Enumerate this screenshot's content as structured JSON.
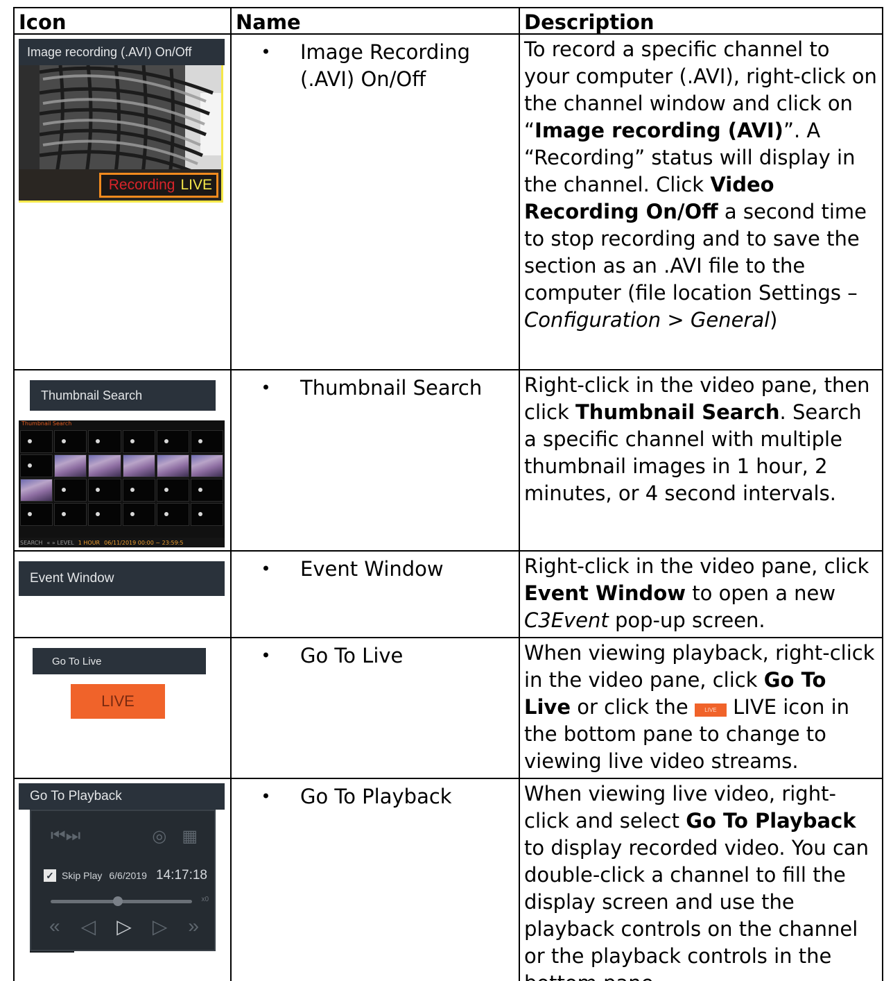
{
  "headers": {
    "icon": "Icon",
    "name": "Name",
    "description": "Description"
  },
  "rows": [
    {
      "name": "Image Recording (.AVI) On/Off",
      "image": {
        "menu_label": "Image recording (.AVI) On/Off",
        "overlay_status": "Recording",
        "overlay_live": "LIVE"
      },
      "desc": {
        "p1": "To record a specific channel to your computer (.AVI), right-click on the channel window and click on “",
        "b1": "Image recording (AVI)",
        "p2": "”.  A “Recording” status will display in the channel.  Click ",
        "b2": "Video Recording On/Off",
        "p3": " a second time to stop recording and to save the section as an .AVI file to the computer (file location Settings –  ",
        "i1": "Configuration > General",
        "p4": ")"
      }
    },
    {
      "name": "Thumbnail Search",
      "image": {
        "menu_label": "Thumbnail Search",
        "window_title": "Thumbnail Search",
        "footer_search": "SEARCH",
        "footer_level": "LEVEL",
        "footer_hour": "1 HOUR",
        "footer_range": "06/11/2019 00:00 ~ 23:59:5"
      },
      "desc": {
        "p1": "Right-click in the video pane, then click ",
        "b1": "Thumbnail Search",
        "p2": ". Search a specific channel with multiple thumbnail images in 1 hour, 2 minutes, or 4 second intervals."
      }
    },
    {
      "name": "Event Window",
      "image": {
        "menu_label": "Event Window"
      },
      "desc": {
        "p1": "Right-click in the video pane, click ",
        "b1": "Event Window",
        "p2": " to open a new ",
        "i1": "C3Event",
        "p3": " pop-up screen."
      }
    },
    {
      "name": "Go To Live",
      "image": {
        "menu_label": "Go To Live",
        "button_label": "LIVE"
      },
      "desc": {
        "p1": "When viewing playback, right-click in the video pane, click ",
        "b1": "Go To Live",
        "p2": " or click the ",
        "inline_icon": "LIVE",
        "p3": " LIVE icon in the bottom pane to change to viewing live video streams."
      }
    },
    {
      "name": "Go To Playback",
      "image": {
        "menu_label": "Go To Playback",
        "skip_label": "Skip Play",
        "date": "6/6/2019",
        "time": "14:17:18",
        "speed": "x0"
      },
      "desc": {
        "p1": "When viewing live video, right-click and select ",
        "b1": "Go To Playback",
        "p2": " to display recorded video.  You can double-click a channel to fill the display screen and use the playback controls on the channel or the playback controls in the bottom pane."
      }
    }
  ],
  "colors": {
    "menu_bg": "#2a323b",
    "live_orange": "#f0632a",
    "rec_border": "#f08a1e",
    "frame_yellow": "#f5e84a"
  }
}
